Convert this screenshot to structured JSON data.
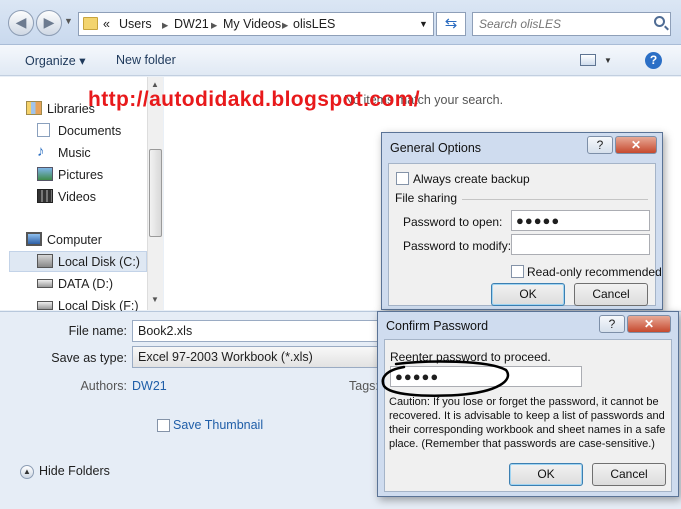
{
  "explorer": {
    "address": [
      "«",
      "Users",
      "DW21",
      "My Videos",
      "olisLES"
    ],
    "search_placeholder": "Search olisLES",
    "toolbar": {
      "organize": "Organize",
      "new_folder": "New folder"
    },
    "nav": [
      {
        "label": "Libraries",
        "icon": "libraries-icon"
      },
      {
        "label": "Documents",
        "icon": "documents-icon"
      },
      {
        "label": "Music",
        "icon": "music-icon"
      },
      {
        "label": "Pictures",
        "icon": "pictures-icon"
      },
      {
        "label": "Videos",
        "icon": "videos-icon"
      },
      {
        "label": "Computer",
        "icon": "computer-icon"
      },
      {
        "label": "Local Disk (C:)",
        "icon": "drive-c-icon",
        "selected": true
      },
      {
        "label": "DATA (D:)",
        "icon": "drive-d-icon"
      },
      {
        "label": "Local Disk (F:)",
        "icon": "drive-f-icon"
      }
    ],
    "empty_message": "No items match your search.",
    "file_name_label": "File name:",
    "file_name": "Book2.xls",
    "save_as_label": "Save as type:",
    "save_as_value": "Excel 97-2003 Workbook (*.xls)",
    "authors_label": "Authors:",
    "authors_value": "DW21",
    "tags_label": "Tags:",
    "save_thumbnail": "Save Thumbnail",
    "hide_folders": "Hide Folders"
  },
  "watermark": "http://autodidakd.blogspot.com/",
  "general_options": {
    "title": "General Options",
    "help": "?",
    "close": "✕",
    "always_backup": "Always create backup",
    "file_sharing": "File sharing",
    "pw_open_label": "Password to open:",
    "pw_open_value": "●●●●●",
    "pw_modify_label": "Password to modify:",
    "pw_modify_value": "",
    "read_only": "Read-only recommended",
    "ok": "OK",
    "cancel": "Cancel"
  },
  "confirm_password": {
    "title": "Confirm Password",
    "help": "?",
    "close": "✕",
    "prompt": "Reenter password to proceed.",
    "value": "●●●●●",
    "caution": "Caution: If you lose or forget the password, it cannot be recovered. It is advisable to keep a list of passwords and their corresponding workbook and sheet names in a safe place.  (Remember that passwords are case-sensitive.)",
    "ok": "OK",
    "cancel": "Cancel"
  }
}
